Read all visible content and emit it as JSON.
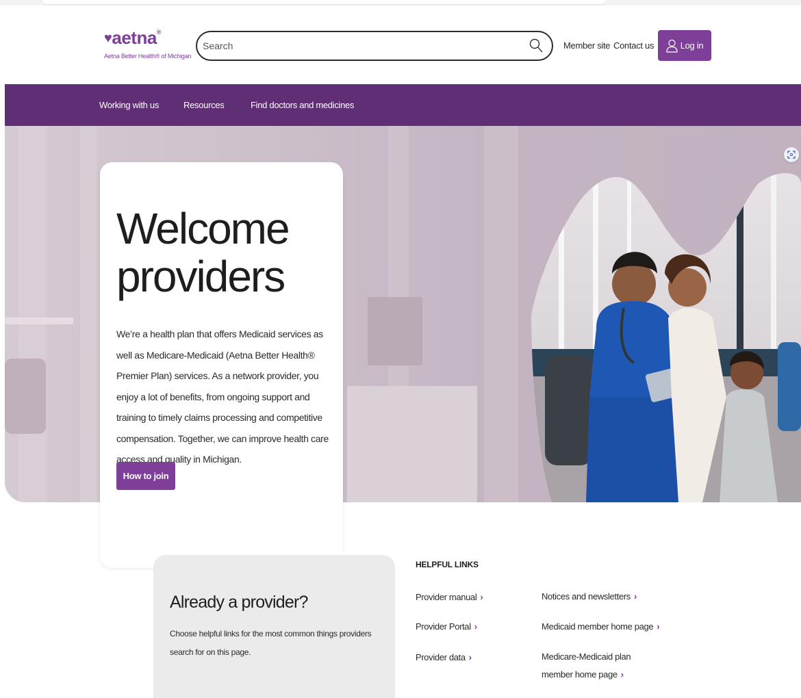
{
  "brand": {
    "name": "aetna",
    "subtitle": "Aetna Better Health® of Michigan",
    "color": "#7d3f98"
  },
  "header": {
    "search_placeholder": "Search",
    "search_icon": "search-icon",
    "member_site": "Member site",
    "contact_us": "Contact us",
    "login": "Log in",
    "login_icon": "user-icon"
  },
  "nav": {
    "items": [
      {
        "label": "Working with us"
      },
      {
        "label": "Resources"
      },
      {
        "label": "Find doctors and medicines"
      }
    ],
    "background": "#5f2e74"
  },
  "hero": {
    "title": "Welcome providers",
    "body": "We’re a health plan that offers Medicaid services as well as Medicare-Medicaid (Aetna Better Health® Premier Plan) services. As a network provider, you enjoy a lot of benefits, from ongoing support and training to timely claims processing and competitive compensation. Together, we can improve health care access and quality in Michigan.",
    "cta": "How to join"
  },
  "provider": {
    "title": "Already a provider?",
    "body": "Choose helpful links for the most common things providers search for on this page."
  },
  "helpful_links": {
    "heading": "HELPFUL LINKS",
    "items": [
      {
        "label": "Provider manual"
      },
      {
        "label": "Provider Portal"
      },
      {
        "label": "Provider data"
      },
      {
        "label": "Notices and newsletters"
      },
      {
        "label": "Medicaid member home page"
      },
      {
        "label": "Medicare-Medicaid plan member home page"
      }
    ]
  }
}
